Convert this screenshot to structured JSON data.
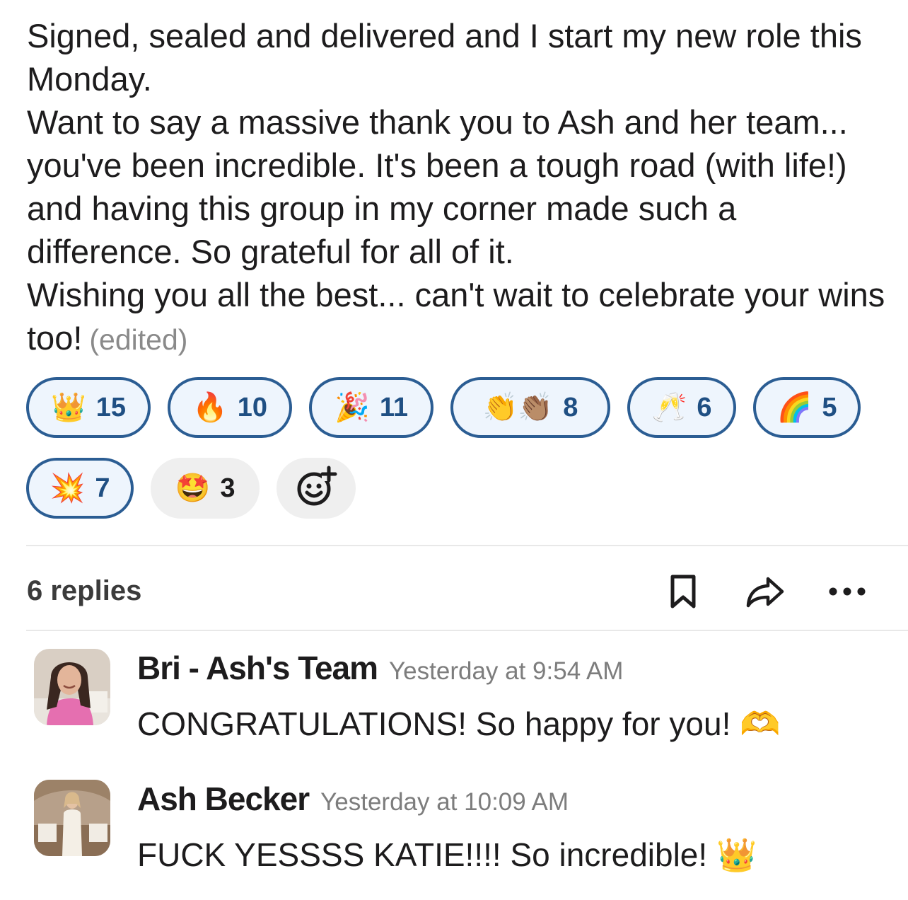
{
  "message": {
    "paragraphs": [
      "Signed, sealed and delivered and I start my new role this Monday.",
      "Want to say a massive thank you to Ash and her team... you've been incredible. It's been a tough road (with life!)  and having this group in my corner made such a difference. So grateful for all of it.",
      "Wishing you all the best... can't wait to celebrate your wins too!"
    ],
    "edited_label": "(edited)"
  },
  "reactions": [
    {
      "emoji": "👑",
      "count": "15",
      "selected": true
    },
    {
      "emoji": "🔥",
      "count": "10",
      "selected": true
    },
    {
      "emoji": "🎉",
      "count": "11",
      "selected": true
    },
    {
      "emoji": "👏👏🏽",
      "count": "8",
      "selected": true
    },
    {
      "emoji": "🥂",
      "count": "6",
      "selected": true
    },
    {
      "emoji": "🌈",
      "count": "5",
      "selected": true
    },
    {
      "emoji": "💥",
      "count": "7",
      "selected": true
    },
    {
      "emoji": "🤩",
      "count": "3",
      "selected": false
    }
  ],
  "add_reaction_icon": "add-emoji-icon",
  "thread": {
    "replies_label": "6 replies",
    "icons": [
      "bookmark-icon",
      "share-icon",
      "more-icon"
    ]
  },
  "replies": [
    {
      "author": "Bri - Ash's Team",
      "time": "Yesterday at 9:54 AM",
      "text": "CONGRATULATIONS! So happy for you! 🫶"
    },
    {
      "author": "Ash Becker",
      "time": "Yesterday at 10:09 AM",
      "text": "FUCK YESSSS KATIE!!!! So incredible! 👑"
    }
  ],
  "colors": {
    "selected_border": "#2b5d93",
    "selected_bg": "#eef5fd",
    "selected_text": "#1f4f83",
    "neutral_bg": "#efefef",
    "timestamp": "#7d7d7d"
  }
}
